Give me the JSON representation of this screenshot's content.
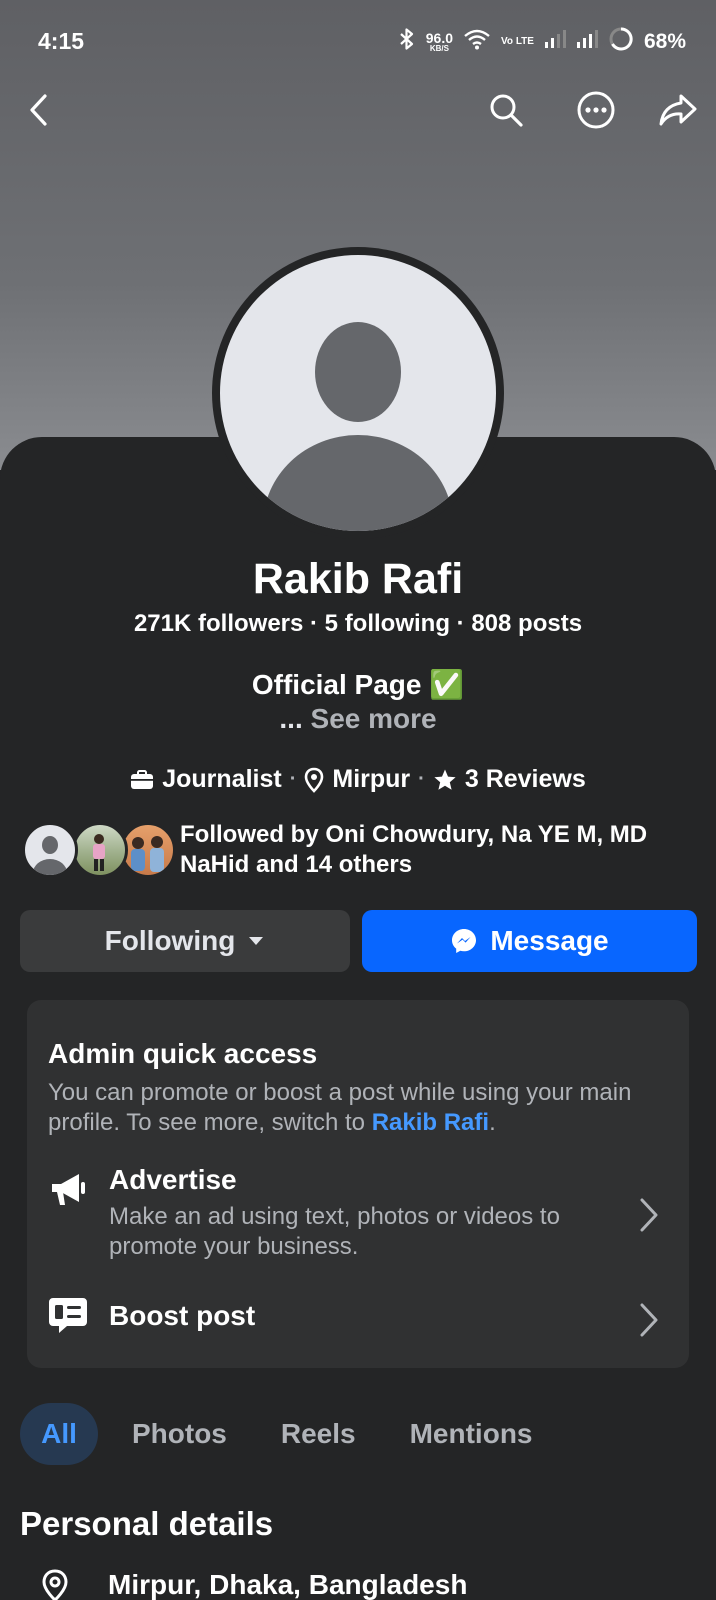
{
  "status_bar": {
    "time": "4:15",
    "net_speed": "96.0",
    "net_unit": "KB/S",
    "volte": "Vo LTE",
    "battery": "68%"
  },
  "profile": {
    "name": "Rakib Rafi",
    "stats": "271K followers · 5 following · 808 posts",
    "bio": "Official Page ✅",
    "see_more_dots": "...",
    "see_more": "See more",
    "category": "Journalist",
    "location": "Mirpur",
    "reviews": "3 Reviews",
    "followed_by": "Followed by Oni Chowdury, Na YE M, MD NaHid and 14 others"
  },
  "actions": {
    "following_label": "Following",
    "message_label": "Message"
  },
  "admin": {
    "title": "Admin quick access",
    "desc_prefix": "You can promote or boost a post while using your main profile. To see more, switch to ",
    "desc_link": "Rakib Rafi",
    "desc_suffix": ".",
    "advertise_title": "Advertise",
    "advertise_desc": "Make an ad using text, photos or videos to promote your business.",
    "boost_title": "Boost post"
  },
  "tabs": [
    "All",
    "Photos",
    "Reels",
    "Mentions"
  ],
  "personal_details": {
    "title": "Personal details",
    "location": "Mirpur, Dhaka, Bangladesh"
  },
  "colors": {
    "background": "#242526",
    "primary_blue": "#0866ff",
    "link_blue": "#4599ff",
    "card": "#303132"
  }
}
